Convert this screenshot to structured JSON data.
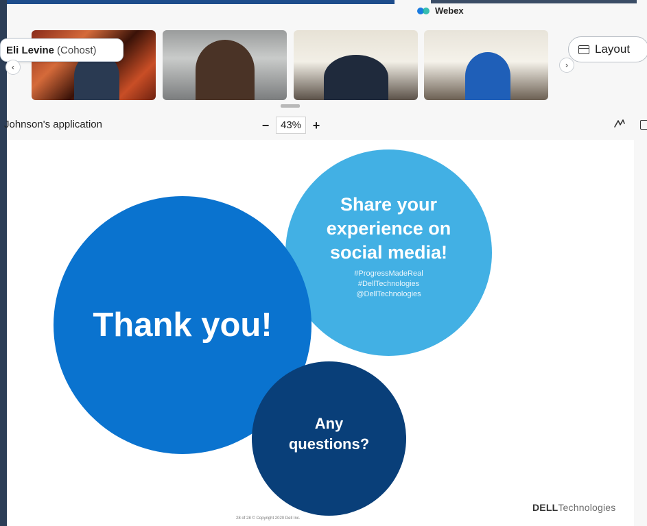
{
  "app": {
    "name": "Webex"
  },
  "participants": [
    {
      "name": "Eli Levine",
      "role": "(Cohost)"
    },
    {
      "name": "",
      "role": ""
    },
    {
      "name": "",
      "role": ""
    },
    {
      "name": "",
      "role": ""
    }
  ],
  "layout_button": {
    "label": "Layout"
  },
  "share_bar": {
    "title": "Johnson's application",
    "zoom": "43%",
    "zoom_out": "−",
    "zoom_in": "+"
  },
  "slide": {
    "thank_you": "Thank you!",
    "share_line1": "Share your",
    "share_line2": "experience on",
    "share_line3": "social media!",
    "hashtags": [
      "#ProgressMadeReal",
      "#DellTechnologies",
      "@DellTechnologies"
    ],
    "questions_line1": "Any",
    "questions_line2": "questions?",
    "footer": "28 of 28   © Copyright 2020 Dell Inc.",
    "brand_bold": "DELL",
    "brand_rest": "Technologies"
  },
  "colors": {
    "thank_you": "#0a73cf",
    "share": "#42b0e4",
    "questions": "#093f79"
  },
  "icons": [
    "webex-logo-icon",
    "chevron-left-icon",
    "chevron-right-icon",
    "layout-icon",
    "annotate-icon",
    "share-screen-icon"
  ]
}
